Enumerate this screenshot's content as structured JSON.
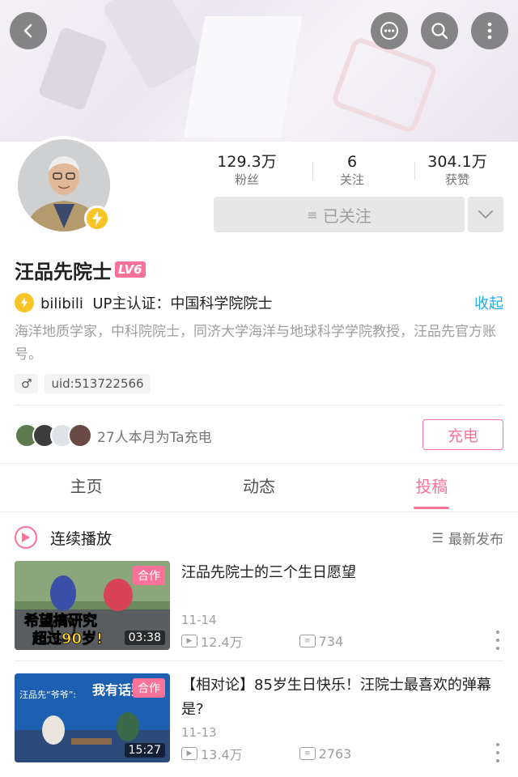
{
  "stats": [
    {
      "value": "129.3万",
      "label": "粉丝"
    },
    {
      "value": "6",
      "label": "关注"
    },
    {
      "value": "304.1万",
      "label": "获赞"
    }
  ],
  "follow_button": {
    "icon": "≡",
    "label": "已关注"
  },
  "profile": {
    "name": "汪品先院士",
    "level": "LV6",
    "cert_source": "bilibili",
    "cert_text": "UP主认证：中国科学院院士",
    "collapse_label": "收起",
    "bio": "海洋地质学家，中科院院士，同济大学海洋与地球科学学院教授，汪品先官方账号。",
    "gender_symbol": "♂",
    "uid": "uid:513722566"
  },
  "charge": {
    "text": "27人本月为Ta充电",
    "button_label": "充电"
  },
  "tabs": [
    {
      "label": "主页"
    },
    {
      "label": "动态"
    },
    {
      "label": "投稿"
    }
  ],
  "playlist": {
    "label": "连续播放",
    "sort_icon": "☰",
    "sort_label": "最新发布"
  },
  "videos": [
    {
      "title": "汪品先院士的三个生日愿望",
      "badge": "合作",
      "duration": "03:38",
      "date": "11-14",
      "views": "12.4万",
      "danmaku": "734",
      "thumb_text": "希望搞研究",
      "thumb_text2": "超过90岁!"
    },
    {
      "title": "【相对论】85岁生日快乐！汪院士最喜欢的弹幕是?",
      "badge": "合作",
      "duration": "15:27",
      "date": "11-13",
      "views": "13.4万",
      "danmaku": "2763",
      "thumb_text": "汪品先“爷爷”:",
      "thumb_text2": "我有话要说"
    }
  ],
  "colors": {
    "accent": "#fb7299",
    "link": "#23ade5",
    "verify": "#f8c426"
  }
}
